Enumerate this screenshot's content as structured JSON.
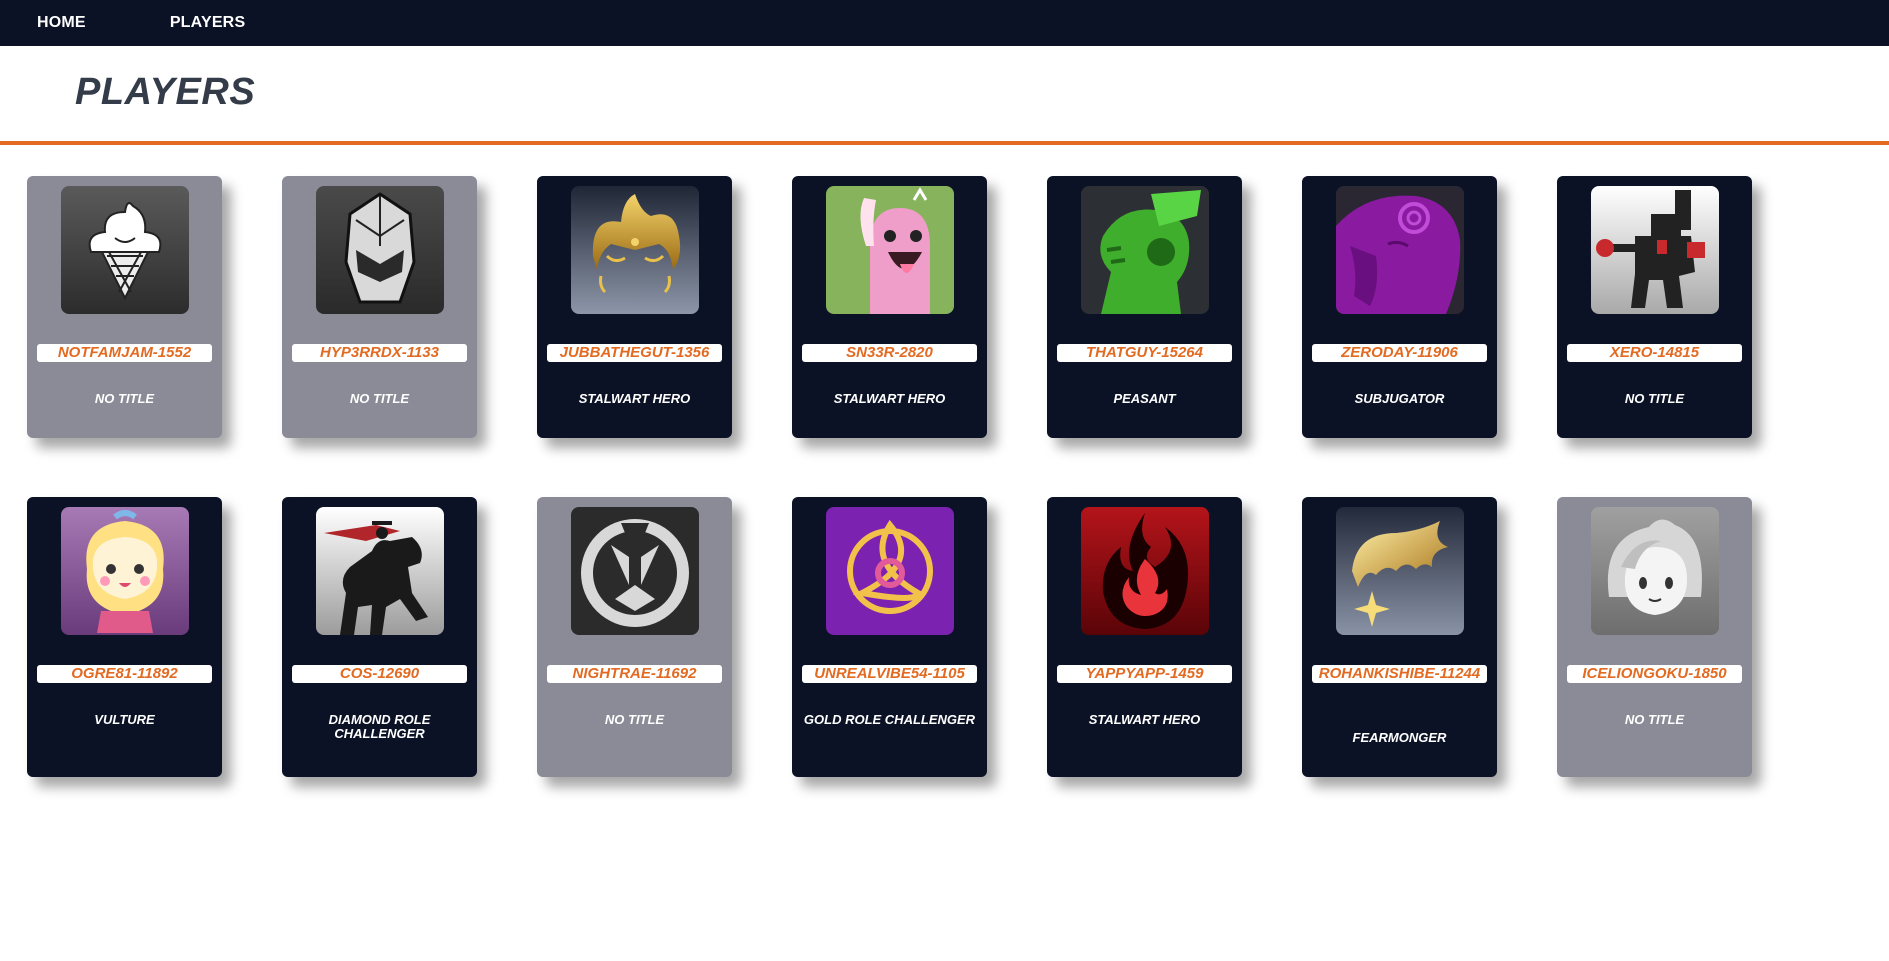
{
  "nav": {
    "home": "HOME",
    "players": "PLAYERS"
  },
  "page": {
    "title": "PLAYERS"
  },
  "colors": {
    "accent": "#e26a21",
    "nav_bg": "#0c1226",
    "card_dark": "#0c1226",
    "card_gray": "#8a8b96"
  },
  "players": [
    {
      "name": "NOTFAMJAM-1552",
      "title": "NO TITLE",
      "style": "gray",
      "icon": "ice-cream-icon"
    },
    {
      "name": "HYP3RRDX-1133",
      "title": "NO TITLE",
      "style": "gray",
      "icon": "helmet-icon"
    },
    {
      "name": "JUBBATHEGUT-1356",
      "title": "STALWART HERO",
      "style": "dark",
      "icon": "golden-hero-icon"
    },
    {
      "name": "SN33R-2820",
      "title": "STALWART HERO",
      "style": "dark",
      "icon": "pink-creature-icon"
    },
    {
      "name": "THATGUY-15264",
      "title": "PEASANT",
      "style": "dark",
      "icon": "green-soldier-icon"
    },
    {
      "name": "ZERODAY-11906",
      "title": "SUBJUGATOR",
      "style": "dark",
      "icon": "purple-face-icon"
    },
    {
      "name": "XERO-14815",
      "title": "NO TITLE",
      "style": "dark",
      "icon": "robot-boxer-icon"
    },
    {
      "name": "OGRE81-11892",
      "title": "VULTURE",
      "style": "dark",
      "icon": "cute-hero-icon"
    },
    {
      "name": "COS-12690",
      "title": "DIAMOND ROLE CHALLENGER",
      "style": "dark",
      "icon": "horse-rider-icon"
    },
    {
      "name": "NIGHTRAE-11692",
      "title": "NO TITLE",
      "style": "gray",
      "icon": "overwatch-logo-icon"
    },
    {
      "name": "UNREALVIBE54-1105",
      "title": "GOLD ROLE CHALLENGER",
      "style": "dark",
      "icon": "gold-triquetra-icon"
    },
    {
      "name": "YAPPYAPP-1459",
      "title": "STALWART HERO",
      "style": "dark",
      "icon": "flame-icon"
    },
    {
      "name": "ROHANKISHIBE-11244",
      "title": "FEARMONGER",
      "style": "dark",
      "icon": "golden-hair-icon"
    },
    {
      "name": "ICELIONGOKU-1850",
      "title": "NO TITLE",
      "style": "gray",
      "icon": "chibi-face-icon"
    }
  ]
}
